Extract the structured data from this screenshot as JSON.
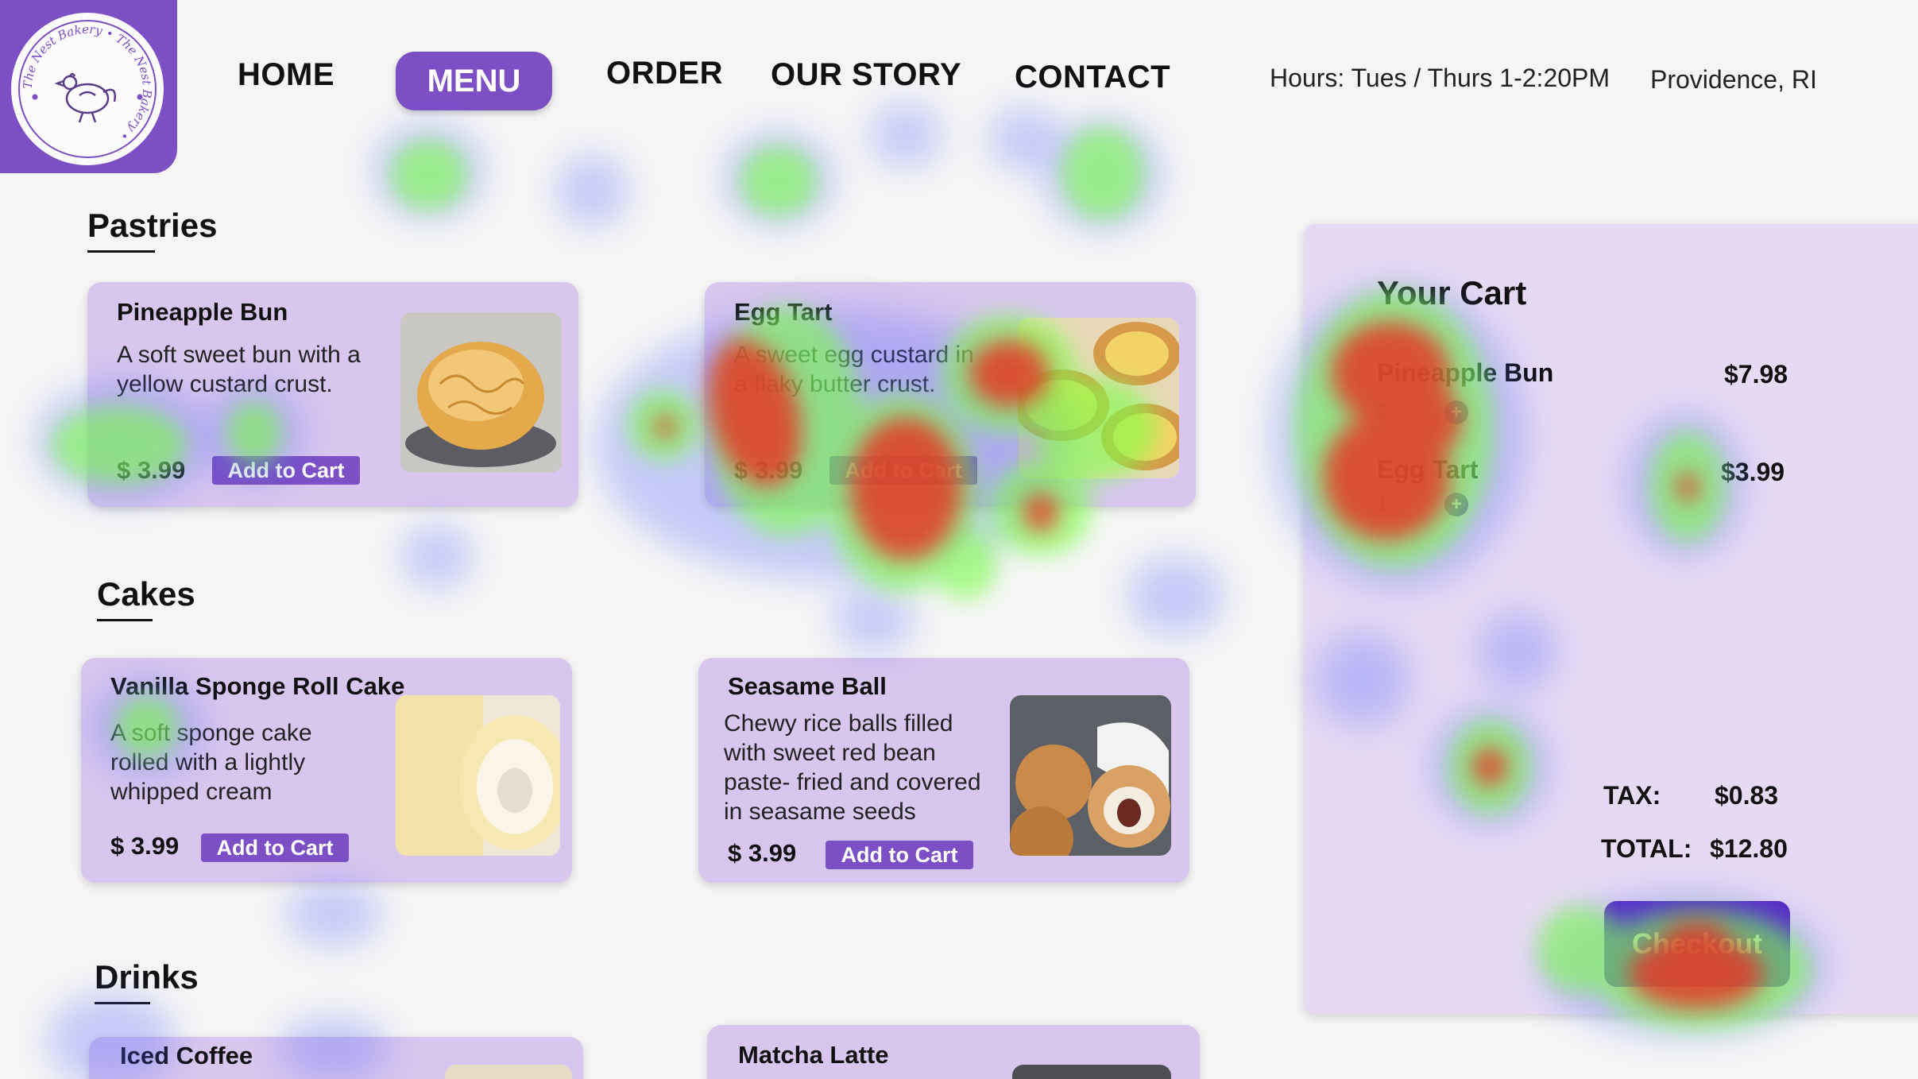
{
  "logo": {
    "ring_text": "The Nest Bakery",
    "icon": "hen-icon"
  },
  "nav": {
    "home": "HOME",
    "menu": "MENU",
    "order": "ORDER",
    "our_story": "OUR STORY",
    "contact": "CONTACT"
  },
  "info": {
    "hours": "Hours: Tues / Thurs 1-2:20PM",
    "location": "Providence, RI"
  },
  "sections": {
    "pastries": "Pastries",
    "cakes": "Cakes",
    "drinks": "Drinks"
  },
  "items": [
    {
      "title": "Pineapple Bun",
      "desc1": "A soft sweet bun with a",
      "desc2": "yellow custard crust.",
      "price": "$ 3.99",
      "button": "Add to Cart"
    },
    {
      "title": "Egg Tart",
      "desc1": "A sweet egg custard in",
      "desc2": "a flaky butter crust.",
      "price": "$ 3.99",
      "button": "Add to Cart"
    },
    {
      "title": "Vanilla Sponge Roll Cake",
      "desc1": "A soft sponge cake",
      "desc2": "rolled with a lightly",
      "desc3": "whipped cream",
      "price": "$ 3.99",
      "button": "Add to Cart"
    },
    {
      "title": "Seasame Ball",
      "desc1": "Chewy rice balls filled",
      "desc2": "with sweet red bean",
      "desc3": "paste- fried and covered",
      "desc4": "in seasame seeds",
      "price": "$ 3.99",
      "button": "Add to Cart"
    },
    {
      "title": "Iced Coffee"
    },
    {
      "title": "Matcha Latte"
    }
  ],
  "cart": {
    "title": "Your Cart",
    "items": [
      {
        "name": "Pineapple Bun",
        "qty": "2",
        "price": "$7.98"
      },
      {
        "name": "Egg Tart",
        "qty": "1",
        "price": "$3.99"
      }
    ],
    "tax_label": "TAX:",
    "tax_value": "$0.83",
    "total_label": "TOTAL:",
    "total_value": "$12.80",
    "checkout": "Checkout"
  },
  "colors": {
    "accent": "#7d4fc4",
    "card_bg": "#d8c6ee",
    "cart_bg": "#e6daf3",
    "page_bg": "#f5f5f5"
  }
}
